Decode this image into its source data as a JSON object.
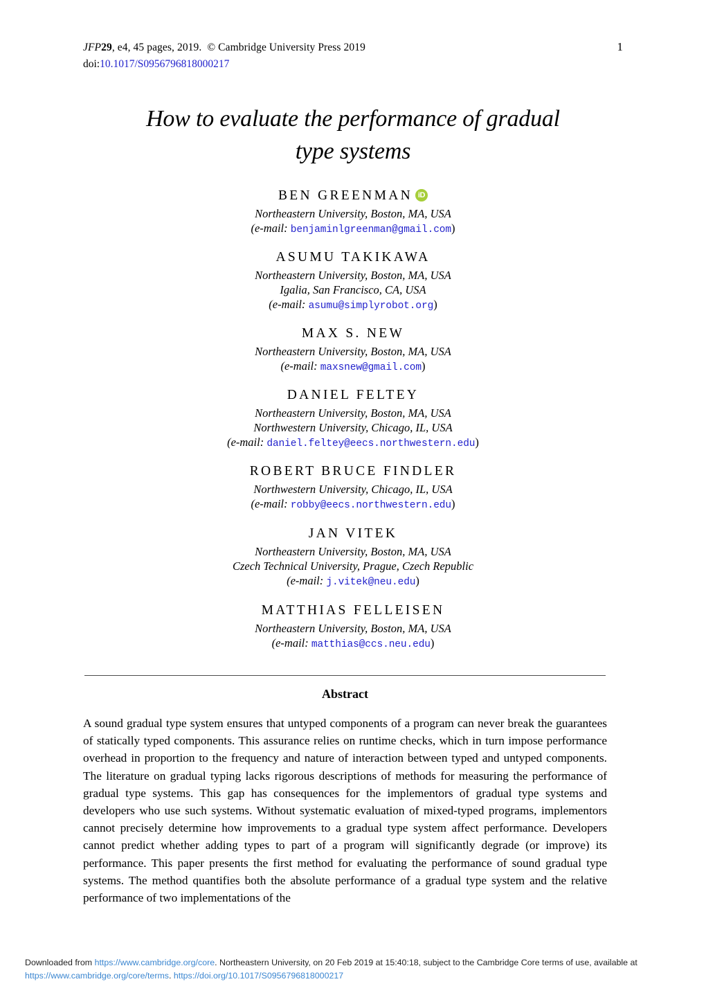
{
  "running_head": {
    "journal": "JFP",
    "volume": "29",
    "rest": ", e4, 45 pages, 2019.",
    "copyright": "© Cambridge University Press 2019",
    "doi_label": "doi:",
    "doi_value": "10.1017/S0956796818000217",
    "page_number": "1"
  },
  "title": {
    "line1": "How to evaluate the performance of gradual",
    "line2": "type systems"
  },
  "authors": [
    {
      "name": "BEN GREENMAN",
      "orcid_icon": "orcid-id-icon",
      "orcid_text": "iD",
      "affiliations": [
        "Northeastern University, Boston, MA, USA"
      ],
      "email_label": "(e-mail:",
      "email": "benjaminlgreenman@gmail.com",
      "email_close": ")"
    },
    {
      "name": "ASUMU TAKIKAWA",
      "affiliations": [
        "Northeastern University, Boston, MA, USA",
        "Igalia, San Francisco, CA, USA"
      ],
      "email_label": "(e-mail:",
      "email": "asumu@simplyrobot.org",
      "email_close": ")"
    },
    {
      "name": "MAX S. NEW",
      "affiliations": [
        "Northeastern University, Boston, MA, USA"
      ],
      "email_label": "(e-mail:",
      "email": "maxsnew@gmail.com",
      "email_close": ")"
    },
    {
      "name": "DANIEL FELTEY",
      "affiliations": [
        "Northeastern University, Boston, MA, USA",
        "Northwestern University, Chicago, IL, USA"
      ],
      "email_label": "(e-mail:",
      "email": "daniel.feltey@eecs.northwestern.edu",
      "email_close": ")"
    },
    {
      "name": "ROBERT BRUCE FINDLER",
      "affiliations": [
        "Northwestern University, Chicago, IL, USA"
      ],
      "email_label": "(e-mail:",
      "email": "robby@eecs.northwestern.edu",
      "email_close": ")"
    },
    {
      "name": "JAN VITEK",
      "affiliations": [
        "Northeastern University, Boston, MA, USA",
        "Czech Technical University, Prague, Czech Republic"
      ],
      "email_label": "(e-mail:",
      "email": "j.vitek@neu.edu",
      "email_close": ")"
    },
    {
      "name": "MATTHIAS FELLEISEN",
      "affiliations": [
        "Northeastern University, Boston, MA, USA"
      ],
      "email_label": "(e-mail:",
      "email": "matthias@ccs.neu.edu",
      "email_close": ")"
    }
  ],
  "abstract": {
    "heading": "Abstract",
    "text": "A sound gradual type system ensures that untyped components of a program can never break the guarantees of statically typed components. This assurance relies on runtime checks, which in turn impose performance overhead in proportion to the frequency and nature of interaction between typed and untyped components. The literature on gradual typing lacks rigorous descriptions of methods for measuring the performance of gradual type systems. This gap has consequences for the implementors of gradual type systems and developers who use such systems. Without systematic evaluation of mixed-typed programs, implementors cannot precisely determine how improvements to a gradual type system affect performance. Developers cannot predict whether adding types to part of a program will significantly degrade (or improve) its performance. This paper presents the first method for evaluating the performance of sound gradual type systems. The method quantifies both the absolute performance of a gradual type system and the relative performance of two implementations of the"
  },
  "footer": {
    "prefix": "Downloaded from ",
    "link1": "https://www.cambridge.org/core",
    "mid": ". Northeastern University, on 20 Feb 2019 at 15:40:18, subject to the Cambridge Core terms of use, available at",
    "link2": "https://www.cambridge.org/core/terms",
    "sep": ". ",
    "link3": "https://doi.org/10.1017/S0956796818000217"
  },
  "colors": {
    "link_blue": "#2222cc",
    "footer_blue": "#3b86d0",
    "orcid_green": "#a6ce39",
    "rule_gray": "#4d4d4d"
  }
}
